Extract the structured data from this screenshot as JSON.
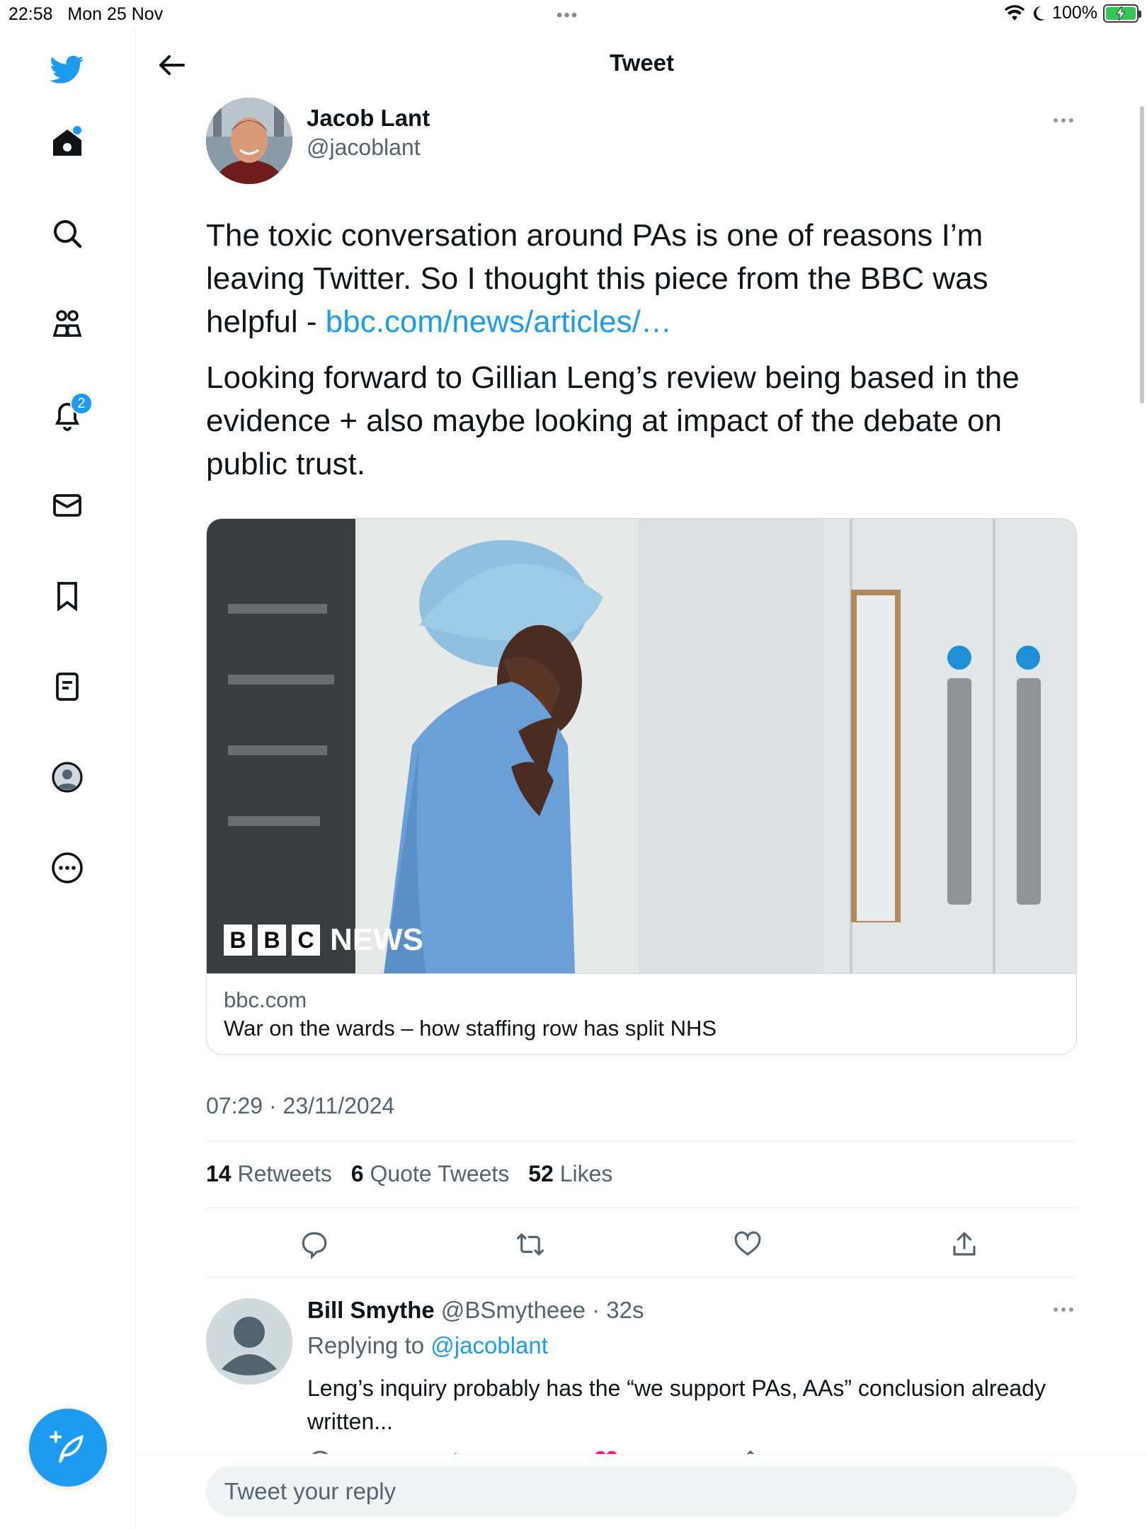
{
  "status_bar": {
    "time": "22:58",
    "date": "Mon 25 Nov",
    "battery": "100%"
  },
  "nav": {
    "items": [
      "home-icon",
      "search-icon",
      "communities-icon",
      "notifications-icon",
      "messages-icon",
      "bookmarks-icon",
      "lists-icon",
      "profile-icon",
      "more-icon"
    ],
    "notifications_badge": "2",
    "accent": "#1d9bf0"
  },
  "header": {
    "title": "Tweet"
  },
  "tweet": {
    "author_name": "Jacob Lant",
    "author_handle": "@jacoblant",
    "para1_text": "The toxic conversation around PAs is one of reasons I’m leaving Twitter. So I thought this piece from the BBC was helpful - ",
    "para1_link": "bbc.com/news/articles/…",
    "para2": "Looking forward to Gillian Leng’s review being based in the evidence + also maybe looking at impact of the debate on public trust.",
    "card": {
      "domain": "bbc.com",
      "title": "War on the wards – how staffing row has split NHS",
      "logo_letters": [
        "B",
        "B",
        "C"
      ],
      "logo_word": "NEWS"
    },
    "timestamp": "07:29 · 23/11/2024",
    "stats": {
      "retweets_count": "14",
      "retweets_label": "Retweets",
      "quotes_count": "6",
      "quotes_label": "Quote Tweets",
      "likes_count": "52",
      "likes_label": "Likes"
    }
  },
  "reply": {
    "name": "Bill Smythe",
    "handle_time": "@BSmytheee · 32s",
    "replying_prefix": "Replying to ",
    "replying_handle": "@jacoblant",
    "text": "Leng’s inquiry probably has the “we support PAs, AAs” conclusion already written..."
  },
  "reply_bar": {
    "placeholder": "Tweet your reply"
  }
}
